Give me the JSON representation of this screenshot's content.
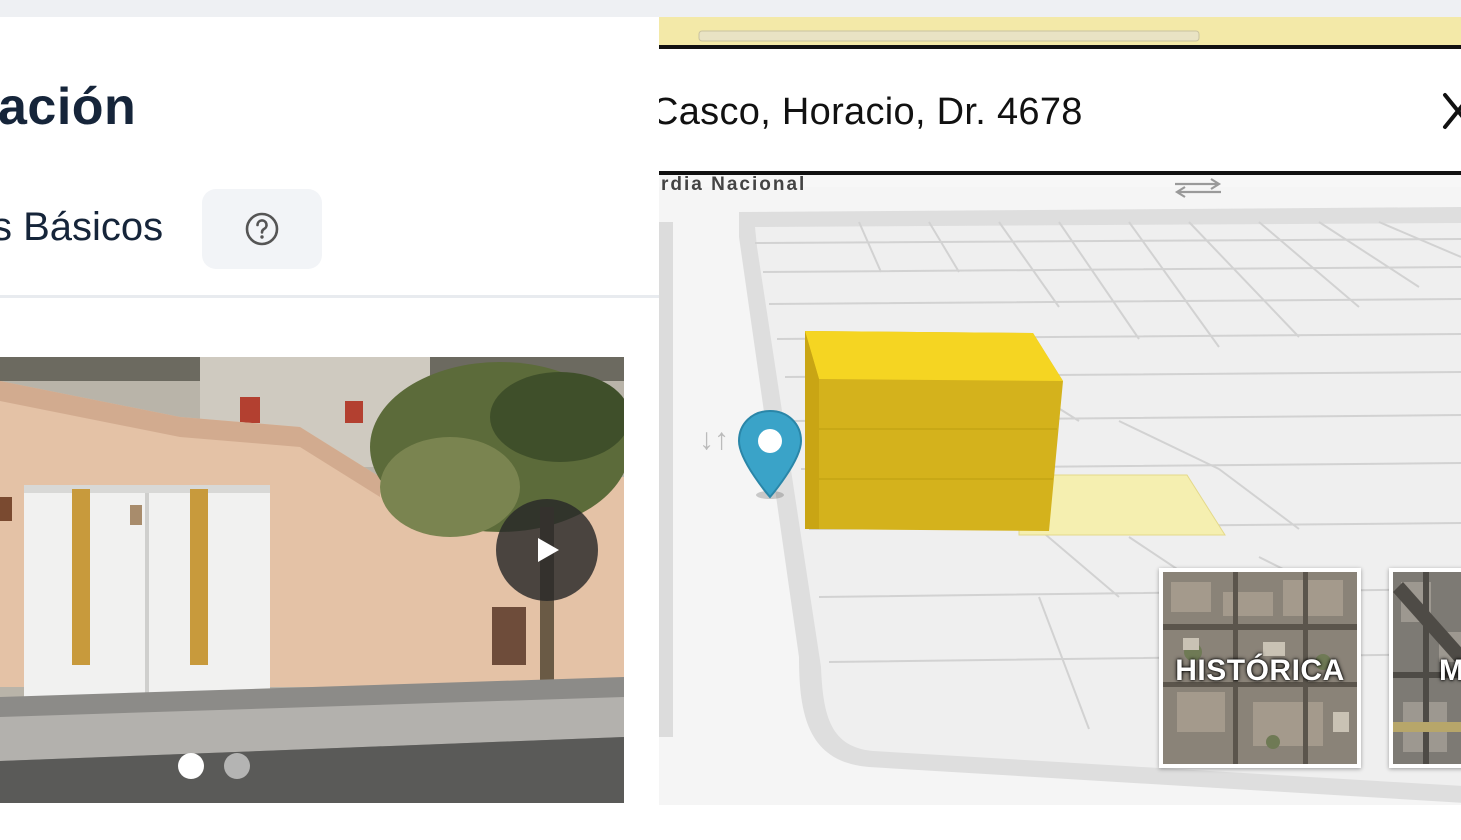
{
  "left": {
    "page_title": "ación",
    "section_heading": "s Básicos",
    "help_icon": "question-circle-icon",
    "carousel": {
      "slides": 2,
      "active_slide": 1,
      "play_icon": "play-icon"
    }
  },
  "map": {
    "address": "Casco, Horacio, Dr. 4678",
    "close_icon": "close-icon",
    "street_label": "rdia Nacional",
    "swap_icon": "two-way-arrows-icon",
    "pin_icon": "location-pin-icon",
    "layers": [
      {
        "label": "HISTÓRICA"
      },
      {
        "label": "M"
      }
    ],
    "colors": {
      "building": "#f2cf1e",
      "lot": "#f5efb0",
      "pin": "#3aa3c8"
    }
  }
}
